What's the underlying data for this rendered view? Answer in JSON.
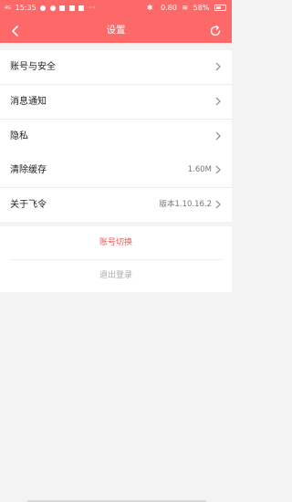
{
  "status_bar": {
    "signal": "4G",
    "time": "15:35",
    "net_speed": "0.80",
    "net_unit": "K/s",
    "battery": "58%"
  },
  "nav": {
    "title": "设置"
  },
  "group1": {
    "items": [
      {
        "label": "账号与安全"
      },
      {
        "label": "消息通知"
      },
      {
        "label": "隐私"
      }
    ]
  },
  "group2": {
    "items": [
      {
        "label": "清除缓存",
        "value": "1.60M"
      },
      {
        "label": "关于飞令",
        "value": "版本1.10.16.2"
      }
    ]
  },
  "actions": {
    "switch_account": "账号切换",
    "logout": "退出登录"
  },
  "colors": {
    "header": "#fd6868",
    "switch_text": "#e85b5b"
  }
}
